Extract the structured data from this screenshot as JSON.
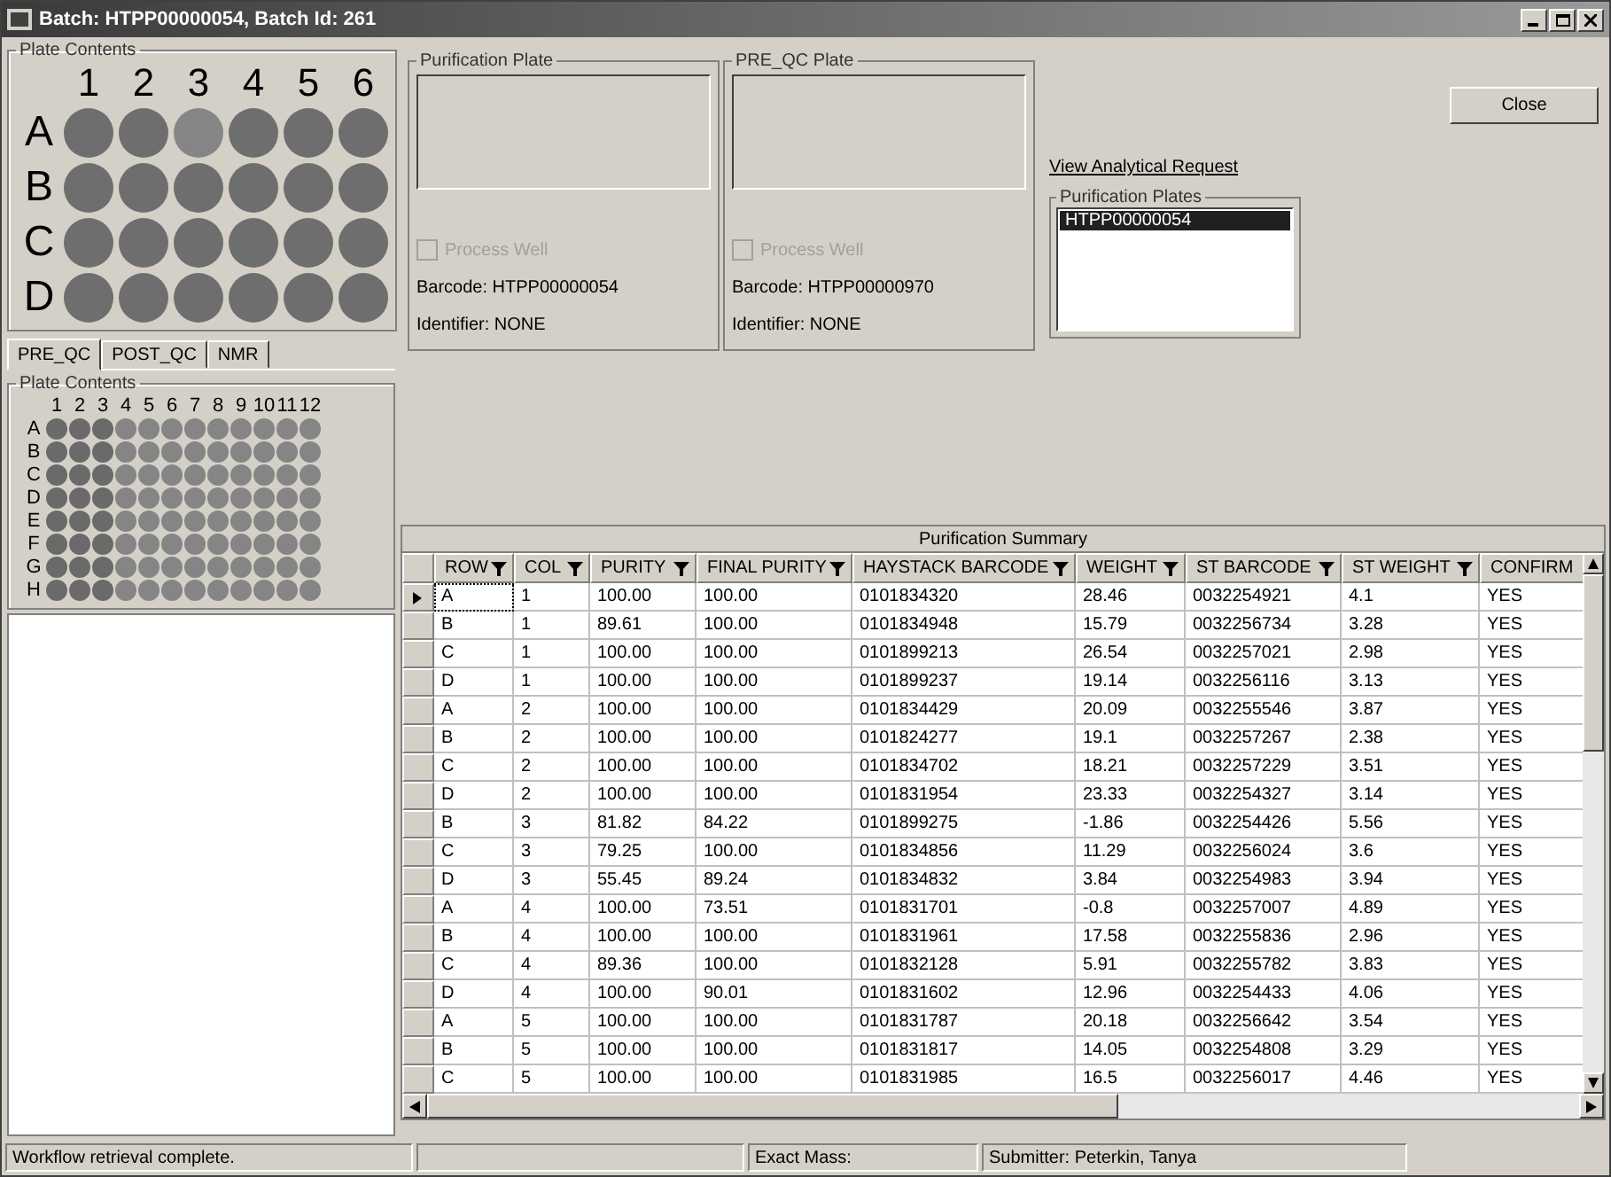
{
  "window": {
    "title": "Batch: HTPP00000054, Batch Id: 261"
  },
  "plate_large": {
    "title": "Plate Contents",
    "columns": [
      "1",
      "2",
      "3",
      "4",
      "5",
      "6"
    ],
    "rows": [
      {
        "label": "A",
        "wells": [
          {
            "color": "#6e6e6e"
          },
          {
            "color": "#6e6e6e"
          },
          {
            "color": "#858585"
          },
          {
            "color": "#6e6e6e"
          },
          {
            "color": "#6e6e6e"
          },
          {
            "color": "#6e6e6e"
          }
        ]
      },
      {
        "label": "B",
        "wells": [
          {
            "color": "#6e6e6e"
          },
          {
            "color": "#6e6e6e"
          },
          {
            "color": "#6e6e6e"
          },
          {
            "color": "#6e6e6e"
          },
          {
            "color": "#6e6e6e"
          },
          {
            "color": "#6e6e6e"
          }
        ]
      },
      {
        "label": "C",
        "wells": [
          {
            "color": "#6e6e6e"
          },
          {
            "color": "#6e6e6e"
          },
          {
            "color": "#6e6e6e"
          },
          {
            "color": "#6e6e6e"
          },
          {
            "color": "#6e6e6e"
          },
          {
            "color": "#6e6e6e"
          }
        ]
      },
      {
        "label": "D",
        "wells": [
          {
            "color": "#6e6e6e"
          },
          {
            "color": "#6e6e6e"
          },
          {
            "color": "#6e6e6e"
          },
          {
            "color": "#6e6e6e"
          },
          {
            "color": "#6e6e6e"
          },
          {
            "color": "#6e6e6e"
          }
        ]
      }
    ]
  },
  "qc_tabs": [
    {
      "label": "PRE_QC",
      "selected": true
    },
    {
      "label": "POST_QC",
      "selected": false
    },
    {
      "label": "NMR",
      "selected": false
    }
  ],
  "plate_small": {
    "title": "Plate Contents",
    "columns": [
      "1",
      "2",
      "3",
      "4",
      "5",
      "6",
      "7",
      "8",
      "9",
      "10",
      "11",
      "12"
    ],
    "rows": [
      {
        "label": "A",
        "wells": [
          {
            "color": "#6a6a6a"
          },
          {
            "color": "#6a6a6a"
          },
          {
            "color": "#6a6a6a"
          },
          {
            "color": "#858585"
          },
          {
            "color": "#858585"
          },
          {
            "color": "#858585"
          },
          {
            "color": "#858585"
          },
          {
            "color": "#858585"
          },
          {
            "color": "#858585"
          },
          {
            "color": "#858585"
          },
          {
            "color": "#858585"
          },
          {
            "color": "#858585"
          }
        ]
      },
      {
        "label": "B",
        "wells": [
          {
            "color": "#6a6a6a"
          },
          {
            "color": "#6a6a6a"
          },
          {
            "color": "#6a6a6a"
          },
          {
            "color": "#858585"
          },
          {
            "color": "#858585"
          },
          {
            "color": "#858585"
          },
          {
            "color": "#858585"
          },
          {
            "color": "#858585"
          },
          {
            "color": "#858585"
          },
          {
            "color": "#858585"
          },
          {
            "color": "#858585"
          },
          {
            "color": "#858585"
          }
        ]
      },
      {
        "label": "C",
        "wells": [
          {
            "color": "#6a6a6a"
          },
          {
            "color": "#6a6a6a"
          },
          {
            "color": "#6a6a6a"
          },
          {
            "color": "#858585"
          },
          {
            "color": "#858585"
          },
          {
            "color": "#858585"
          },
          {
            "color": "#858585"
          },
          {
            "color": "#858585"
          },
          {
            "color": "#858585"
          },
          {
            "color": "#858585"
          },
          {
            "color": "#858585"
          },
          {
            "color": "#858585"
          }
        ]
      },
      {
        "label": "D",
        "wells": [
          {
            "color": "#6a6a6a"
          },
          {
            "color": "#6a6a6a"
          },
          {
            "color": "#6a6a6a"
          },
          {
            "color": "#858585"
          },
          {
            "color": "#858585"
          },
          {
            "color": "#858585"
          },
          {
            "color": "#858585"
          },
          {
            "color": "#858585"
          },
          {
            "color": "#858585"
          },
          {
            "color": "#858585"
          },
          {
            "color": "#858585"
          },
          {
            "color": "#858585"
          }
        ]
      },
      {
        "label": "E",
        "wells": [
          {
            "color": "#6a6a6a"
          },
          {
            "color": "#6a6a6a"
          },
          {
            "color": "#6a6a6a"
          },
          {
            "color": "#858585"
          },
          {
            "color": "#858585"
          },
          {
            "color": "#858585"
          },
          {
            "color": "#858585"
          },
          {
            "color": "#858585"
          },
          {
            "color": "#858585"
          },
          {
            "color": "#858585"
          },
          {
            "color": "#858585"
          },
          {
            "color": "#858585"
          }
        ]
      },
      {
        "label": "F",
        "wells": [
          {
            "color": "#6a6a6a"
          },
          {
            "color": "#6a6a6a"
          },
          {
            "color": "#6a6a6a"
          },
          {
            "color": "#858585"
          },
          {
            "color": "#858585"
          },
          {
            "color": "#858585"
          },
          {
            "color": "#858585"
          },
          {
            "color": "#858585"
          },
          {
            "color": "#858585"
          },
          {
            "color": "#858585"
          },
          {
            "color": "#858585"
          },
          {
            "color": "#858585"
          }
        ]
      },
      {
        "label": "G",
        "wells": [
          {
            "color": "#6a6a6a"
          },
          {
            "color": "#6a6a6a"
          },
          {
            "color": "#6a6a6a"
          },
          {
            "color": "#858585"
          },
          {
            "color": "#858585"
          },
          {
            "color": "#858585"
          },
          {
            "color": "#858585"
          },
          {
            "color": "#858585"
          },
          {
            "color": "#858585"
          },
          {
            "color": "#858585"
          },
          {
            "color": "#858585"
          },
          {
            "color": "#858585"
          }
        ]
      },
      {
        "label": "H",
        "wells": [
          {
            "color": "#6a6a6a"
          },
          {
            "color": "#6a6a6a"
          },
          {
            "color": "#6a6a6a"
          },
          {
            "color": "#858585"
          },
          {
            "color": "#858585"
          },
          {
            "color": "#858585"
          },
          {
            "color": "#858585"
          },
          {
            "color": "#858585"
          },
          {
            "color": "#858585"
          },
          {
            "color": "#858585"
          },
          {
            "color": "#858585"
          },
          {
            "color": "#858585"
          }
        ]
      }
    ]
  },
  "plate_groups": [
    {
      "title": "Purification Plate",
      "process_well": {
        "label": "Process Well",
        "checked": false,
        "disabled": true
      },
      "barcode": "Barcode: HTPP00000054",
      "identifier": "Identifier: NONE"
    },
    {
      "title": "PRE_QC Plate",
      "process_well": {
        "label": "Process Well",
        "checked": false,
        "disabled": true
      },
      "barcode": "Barcode: HTPP00000970",
      "identifier": "Identifier: NONE"
    }
  ],
  "close_button": "Close",
  "analytical_link": "View Analytical Request",
  "purification_plates": {
    "title": "Purification Plates",
    "items": [
      {
        "label": "HTPP00000054",
        "selected": true
      }
    ]
  },
  "table": {
    "title": "Purification Summary",
    "columns": [
      "ROW",
      "COL",
      "PURITY",
      "FINAL PURITY",
      "HAYSTACK BARCODE",
      "WEIGHT",
      "ST BARCODE",
      "ST WEIGHT",
      "CONFIRM"
    ],
    "rows": [
      {
        "selected": true,
        "cells": [
          "A",
          "1",
          "100.00",
          "100.00",
          "0101834320",
          "28.46",
          "0032254921",
          "4.1",
          "YES"
        ]
      },
      {
        "selected": false,
        "cells": [
          "B",
          "1",
          "89.61",
          "100.00",
          "0101834948",
          "15.79",
          "0032256734",
          "3.28",
          "YES"
        ]
      },
      {
        "selected": false,
        "cells": [
          "C",
          "1",
          "100.00",
          "100.00",
          "0101899213",
          "26.54",
          "0032257021",
          "2.98",
          "YES"
        ]
      },
      {
        "selected": false,
        "cells": [
          "D",
          "1",
          "100.00",
          "100.00",
          "0101899237",
          "19.14",
          "0032256116",
          "3.13",
          "YES"
        ]
      },
      {
        "selected": false,
        "cells": [
          "A",
          "2",
          "100.00",
          "100.00",
          "0101834429",
          "20.09",
          "0032255546",
          "3.87",
          "YES"
        ]
      },
      {
        "selected": false,
        "cells": [
          "B",
          "2",
          "100.00",
          "100.00",
          "0101824277",
          "19.1",
          "0032257267",
          "2.38",
          "YES"
        ]
      },
      {
        "selected": false,
        "cells": [
          "C",
          "2",
          "100.00",
          "100.00",
          "0101834702",
          "18.21",
          "0032257229",
          "3.51",
          "YES"
        ]
      },
      {
        "selected": false,
        "cells": [
          "D",
          "2",
          "100.00",
          "100.00",
          "0101831954",
          "23.33",
          "0032254327",
          "3.14",
          "YES"
        ]
      },
      {
        "selected": false,
        "cells": [
          "B",
          "3",
          "81.82",
          "84.22",
          "0101899275",
          "-1.86",
          "0032254426",
          "5.56",
          "YES"
        ]
      },
      {
        "selected": false,
        "cells": [
          "C",
          "3",
          "79.25",
          "100.00",
          "0101834856",
          "11.29",
          "0032256024",
          "3.6",
          "YES"
        ]
      },
      {
        "selected": false,
        "cells": [
          "D",
          "3",
          "55.45",
          "89.24",
          "0101834832",
          "3.84",
          "0032254983",
          "3.94",
          "YES"
        ]
      },
      {
        "selected": false,
        "cells": [
          "A",
          "4",
          "100.00",
          "73.51",
          "0101831701",
          "-0.8",
          "0032257007",
          "4.89",
          "YES"
        ]
      },
      {
        "selected": false,
        "cells": [
          "B",
          "4",
          "100.00",
          "100.00",
          "0101831961",
          "17.58",
          "0032255836",
          "2.96",
          "YES"
        ]
      },
      {
        "selected": false,
        "cells": [
          "C",
          "4",
          "89.36",
          "100.00",
          "0101832128",
          "5.91",
          "0032255782",
          "3.83",
          "YES"
        ]
      },
      {
        "selected": false,
        "cells": [
          "D",
          "4",
          "100.00",
          "90.01",
          "0101831602",
          "12.96",
          "0032254433",
          "4.06",
          "YES"
        ]
      },
      {
        "selected": false,
        "cells": [
          "A",
          "5",
          "100.00",
          "100.00",
          "0101831787",
          "20.18",
          "0032256642",
          "3.54",
          "YES"
        ]
      },
      {
        "selected": false,
        "cells": [
          "B",
          "5",
          "100.00",
          "100.00",
          "0101831817",
          "14.05",
          "0032254808",
          "3.29",
          "YES"
        ]
      },
      {
        "selected": false,
        "cells": [
          "C",
          "5",
          "100.00",
          "100.00",
          "0101831985",
          "16.5",
          "0032256017",
          "4.46",
          "YES"
        ]
      }
    ]
  },
  "status_bar": [
    "Workflow retrieval complete.",
    "Exact Mass:",
    "Submitter: Peterkin, Tanya"
  ]
}
